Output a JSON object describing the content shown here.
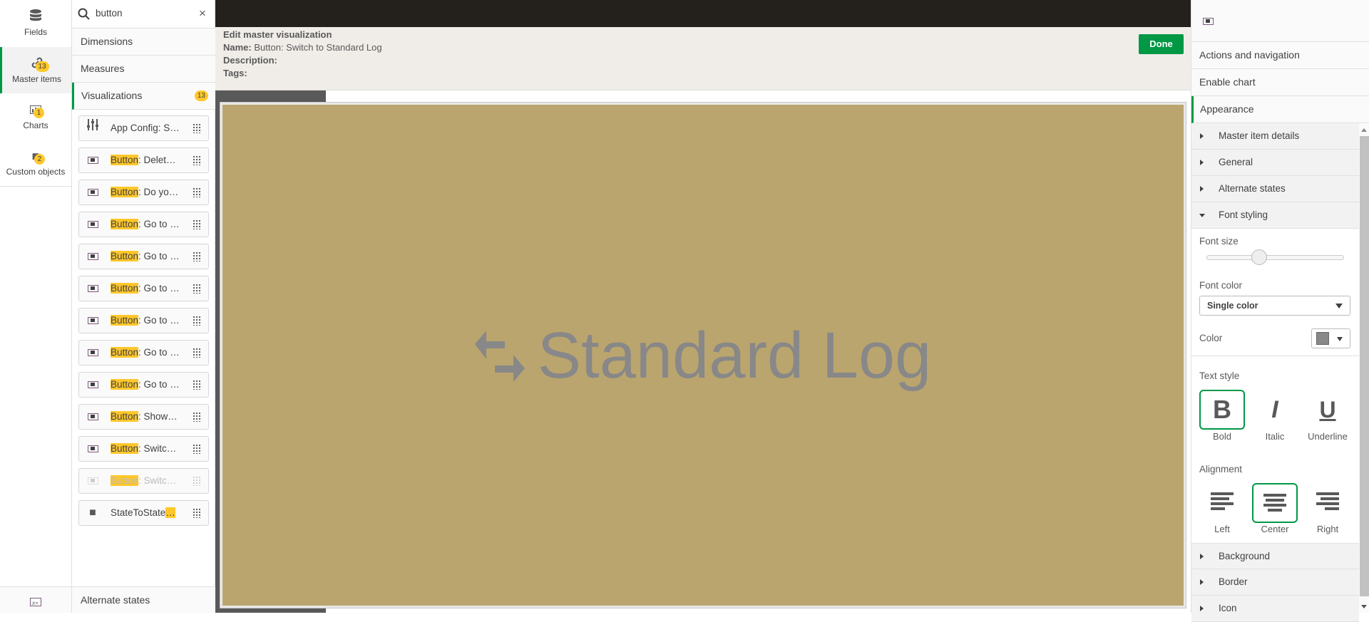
{
  "nav": {
    "items": [
      {
        "label": "Fields",
        "icon": "database-icon"
      },
      {
        "label": "Master items",
        "icon": "link-icon",
        "badge": "13"
      },
      {
        "label": "Charts",
        "icon": "chart-icon",
        "badge": "1"
      },
      {
        "label": "Custom objects",
        "icon": "puzzle-icon",
        "badge": "2"
      }
    ],
    "bottom_icon": "variables-icon"
  },
  "assets": {
    "search": {
      "value": "button"
    },
    "sections": [
      {
        "label": "Dimensions"
      },
      {
        "label": "Measures"
      },
      {
        "label": "Visualizations",
        "badge": "13"
      }
    ],
    "items": [
      {
        "highlight": "",
        "text": "App Config: S…",
        "icon": "sliders-icon",
        "disabled": false
      },
      {
        "highlight": "Button",
        "text": ": Delet…",
        "icon": "button-icon",
        "disabled": false
      },
      {
        "highlight": "Button",
        "text": ": Do yo…",
        "icon": "button-icon",
        "disabled": false
      },
      {
        "highlight": "Button",
        "text": ": Go to …",
        "icon": "button-icon",
        "disabled": false
      },
      {
        "highlight": "Button",
        "text": ": Go to …",
        "icon": "button-icon",
        "disabled": false
      },
      {
        "highlight": "Button",
        "text": ": Go to …",
        "icon": "button-icon",
        "disabled": false
      },
      {
        "highlight": "Button",
        "text": ": Go to …",
        "icon": "button-icon",
        "disabled": false
      },
      {
        "highlight": "Button",
        "text": ": Go to …",
        "icon": "button-icon",
        "disabled": false
      },
      {
        "highlight": "Button",
        "text": ": Go to …",
        "icon": "button-icon",
        "disabled": false
      },
      {
        "highlight": "Button",
        "text": ": Show…",
        "icon": "button-icon",
        "disabled": false
      },
      {
        "highlight": "Button",
        "text": ": Switc…",
        "icon": "button-icon",
        "disabled": false
      },
      {
        "highlight": "Button",
        "text": ": Switc…",
        "icon": "button-icon",
        "disabled": true
      },
      {
        "highlight": "",
        "text": "StateToState",
        "tail": "…",
        "icon": "puzzle-icon",
        "disabled": false
      }
    ],
    "footer": "Alternate states"
  },
  "header": {
    "title": "Edit master visualization",
    "name_label": "Name:",
    "name": "Button: Switch to Standard Log",
    "description_label": "Description:",
    "tags_label": "Tags:",
    "done": "Done"
  },
  "canvas": {
    "button_label": "Standard Log",
    "button_icon": "swap-arrows-icon",
    "background": "#bba56f",
    "text_color": "#888888"
  },
  "props": {
    "tabs": [
      "Actions and navigation",
      "Enable chart",
      "Appearance"
    ],
    "sections": [
      "Master item details",
      "General",
      "Alternate states",
      "Font styling"
    ],
    "font_size_label": "Font size",
    "font_size_value_fraction": 0.38,
    "font_color_label": "Font color",
    "font_color_value": "Single color",
    "color_label": "Color",
    "color_value": "#888888",
    "text_style_label": "Text style",
    "text_styles": [
      {
        "glyph": "B",
        "label": "Bold",
        "selected": true
      },
      {
        "glyph": "I",
        "label": "Italic",
        "selected": false
      },
      {
        "glyph": "U",
        "label": "Underline",
        "selected": false
      }
    ],
    "alignment_label": "Alignment",
    "alignments": [
      {
        "label": "Left",
        "selected": false
      },
      {
        "label": "Center",
        "selected": true
      },
      {
        "label": "Right",
        "selected": false
      }
    ],
    "more_sections": [
      "Background",
      "Border",
      "Icon"
    ]
  },
  "colors": {
    "accent": "#009845",
    "badge": "#ffc72a",
    "topbar": "#24211d"
  }
}
